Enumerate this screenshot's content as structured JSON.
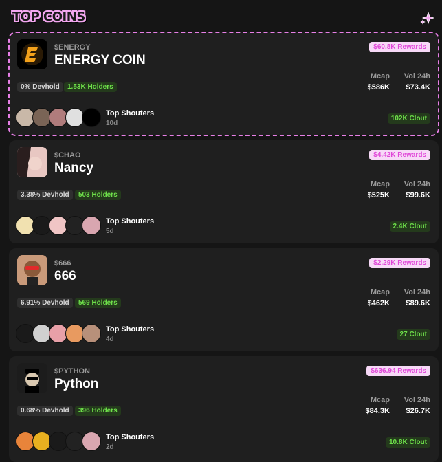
{
  "header": {
    "title": "TOP COINS",
    "icon": "sparkle-icon"
  },
  "cards": [
    {
      "ticker": "$ENERGY",
      "name": "ENERGY COIN",
      "rewards": "$60.8K Rewards",
      "devhold": "0% Devhold",
      "holders": "1.53K Holders",
      "mcap_label": "Mcap",
      "mcap": "$586K",
      "vol_label": "Vol 24h",
      "vol": "$73.4K",
      "shouters_label": "Top Shouters",
      "time": "10d",
      "clout": "102K Clout",
      "highlight": true,
      "avatar_color": "#000000",
      "accent": "#f5a21b"
    },
    {
      "ticker": "$CHAO",
      "name": "Nancy",
      "rewards": "$4.42K Rewards",
      "devhold": "3.38% Devhold",
      "holders": "503 Holders",
      "mcap_label": "Mcap",
      "mcap": "$525K",
      "vol_label": "Vol 24h",
      "vol": "$99.6K",
      "shouters_label": "Top Shouters",
      "time": "5d",
      "clout": "2.4K Clout",
      "highlight": false,
      "avatar_color": "#e8c7c2",
      "accent": "#3a2a2a"
    },
    {
      "ticker": "$666",
      "name": "666",
      "rewards": "$2.29K Rewards",
      "devhold": "6.91% Devhold",
      "holders": "569 Holders",
      "mcap_label": "Mcap",
      "mcap": "$462K",
      "vol_label": "Vol 24h",
      "vol": "$89.6K",
      "shouters_label": "Top Shouters",
      "time": "4d",
      "clout": "27 Clout",
      "highlight": false,
      "avatar_color": "#a8644a",
      "accent": "#e22a2a"
    },
    {
      "ticker": "$PYTHON",
      "name": "Python",
      "rewards": "$636.94 Rewards",
      "devhold": "0.68% Devhold",
      "holders": "396 Holders",
      "mcap_label": "Mcap",
      "mcap": "$84.3K",
      "vol_label": "Vol 24h",
      "vol": "$26.7K",
      "shouters_label": "Top Shouters",
      "time": "2d",
      "clout": "10.8K Clout",
      "highlight": false,
      "avatar_color": "#1c1c1c",
      "accent": "#d9c8b0"
    }
  ]
}
